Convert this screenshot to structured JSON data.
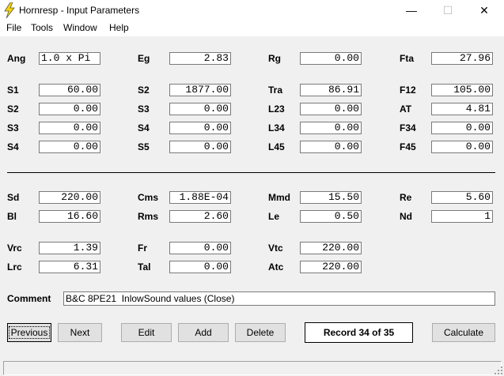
{
  "window": {
    "title": "Hornresp - Input Parameters",
    "minimize": "—",
    "maximize": "☐",
    "close": "✕"
  },
  "menu": [
    "File",
    "Tools",
    "Window",
    "Help"
  ],
  "params": {
    "Ang": "1.0 x Pi",
    "Eg": "2.83",
    "Rg": "0.00",
    "Fta": "27.96",
    "S1": "60.00",
    "S2a": "1877.00",
    "Tra": "86.91",
    "F12": "105.00",
    "S2b": "0.00",
    "S3a": "0.00",
    "L23": "0.00",
    "AT": "4.81",
    "S3b": "0.00",
    "S4a": "0.00",
    "L34": "0.00",
    "F34": "0.00",
    "S4b": "0.00",
    "S5": "0.00",
    "L45": "0.00",
    "F45": "0.00",
    "Sd": "220.00",
    "Cms": "1.88E-04",
    "Mmd": "15.50",
    "Re": "5.60",
    "Bl": "16.60",
    "Rms": "2.60",
    "Le": "0.50",
    "Nd": "1",
    "Vrc": "1.39",
    "Fr": "0.00",
    "Vtc": "220.00",
    "Lrc": "6.31",
    "Tal": "0.00",
    "Atc": "220.00"
  },
  "labels": {
    "Ang": "Ang",
    "Eg": "Eg",
    "Rg": "Rg",
    "Fta": "Fta",
    "S1": "S1",
    "S2": "S2",
    "Tra": "Tra",
    "F12": "F12",
    "S3": "S3",
    "L23": "L23",
    "AT": "AT",
    "S4": "S4",
    "L34": "L34",
    "F34": "F34",
    "S5": "S5",
    "L45": "L45",
    "F45": "F45",
    "Sd": "Sd",
    "Cms": "Cms",
    "Mmd": "Mmd",
    "Re": "Re",
    "Bl": "Bl",
    "Rms": "Rms",
    "Le": "Le",
    "Nd": "Nd",
    "Vrc": "Vrc",
    "Fr": "Fr",
    "Vtc": "Vtc",
    "Lrc": "Lrc",
    "Tal": "Tal",
    "Atc": "Atc",
    "Comment": "Comment"
  },
  "comment": "B&C 8PE21  InlowSound values (Close)",
  "buttons": {
    "previous": "Previous",
    "next": "Next",
    "edit": "Edit",
    "add": "Add",
    "delete": "Delete",
    "calculate": "Calculate"
  },
  "record": "Record 34 of 35"
}
